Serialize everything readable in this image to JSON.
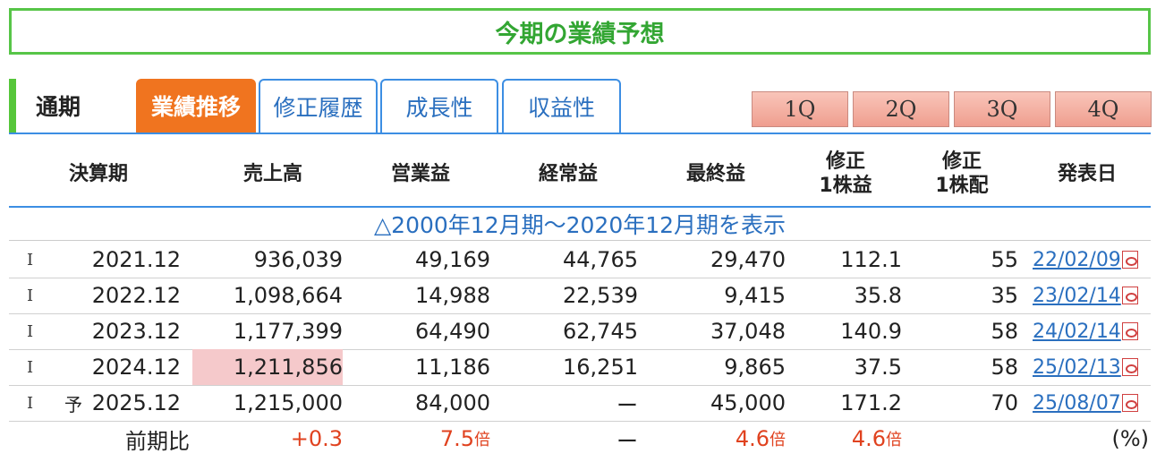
{
  "title": "今期の業績予想",
  "tabs": {
    "plain": "通期",
    "active": "業績推移",
    "outline": [
      "修正履歴",
      "成長性",
      "収益性"
    ],
    "quarters": [
      "1Q",
      "2Q",
      "3Q",
      "4Q"
    ]
  },
  "table": {
    "headers": [
      "決算期",
      "売上高",
      "営業益",
      "経常益",
      "最終益",
      "修正\n1株益",
      "修正\n1株配",
      "発表日"
    ],
    "show_link": "△2000年12月期〜2020年12月期を表示",
    "rows": [
      {
        "mark": "I",
        "forecast": "",
        "period": "2021.12",
        "sales": "936,039",
        "op": "49,169",
        "ordinary": "44,765",
        "net": "29,470",
        "eps": "112.1",
        "div": "55",
        "date": "22/02/09"
      },
      {
        "mark": "I",
        "forecast": "",
        "period": "2022.12",
        "sales": "1,098,664",
        "op": "14,988",
        "ordinary": "22,539",
        "net": "9,415",
        "eps": "35.8",
        "div": "35",
        "date": "23/02/14"
      },
      {
        "mark": "I",
        "forecast": "",
        "period": "2023.12",
        "sales": "1,177,399",
        "op": "64,490",
        "ordinary": "62,745",
        "net": "37,048",
        "eps": "140.9",
        "div": "58",
        "date": "24/02/14"
      },
      {
        "mark": "I",
        "forecast": "",
        "period": "2024.12",
        "sales": "1,211,856",
        "op": "11,186",
        "ordinary": "16,251",
        "net": "9,865",
        "eps": "37.5",
        "div": "58",
        "date": "25/02/13"
      },
      {
        "mark": "I",
        "forecast": "予",
        "period": "2025.12",
        "sales": "1,215,000",
        "op": "84,000",
        "ordinary": "ー",
        "net": "45,000",
        "eps": "171.2",
        "div": "70",
        "date": "25/08/07"
      }
    ],
    "comparison": {
      "label": "前期比",
      "sales": "+0.3",
      "op": "7.5",
      "op_unit": "倍",
      "ordinary": "ー",
      "net": "4.6",
      "net_unit": "倍",
      "eps": "4.6",
      "eps_unit": "倍",
      "unit_note": "(%)"
    },
    "highlight_color": "#f5c9cb",
    "link_color": "#2a6fbf",
    "positive_color": "#e0421f"
  }
}
